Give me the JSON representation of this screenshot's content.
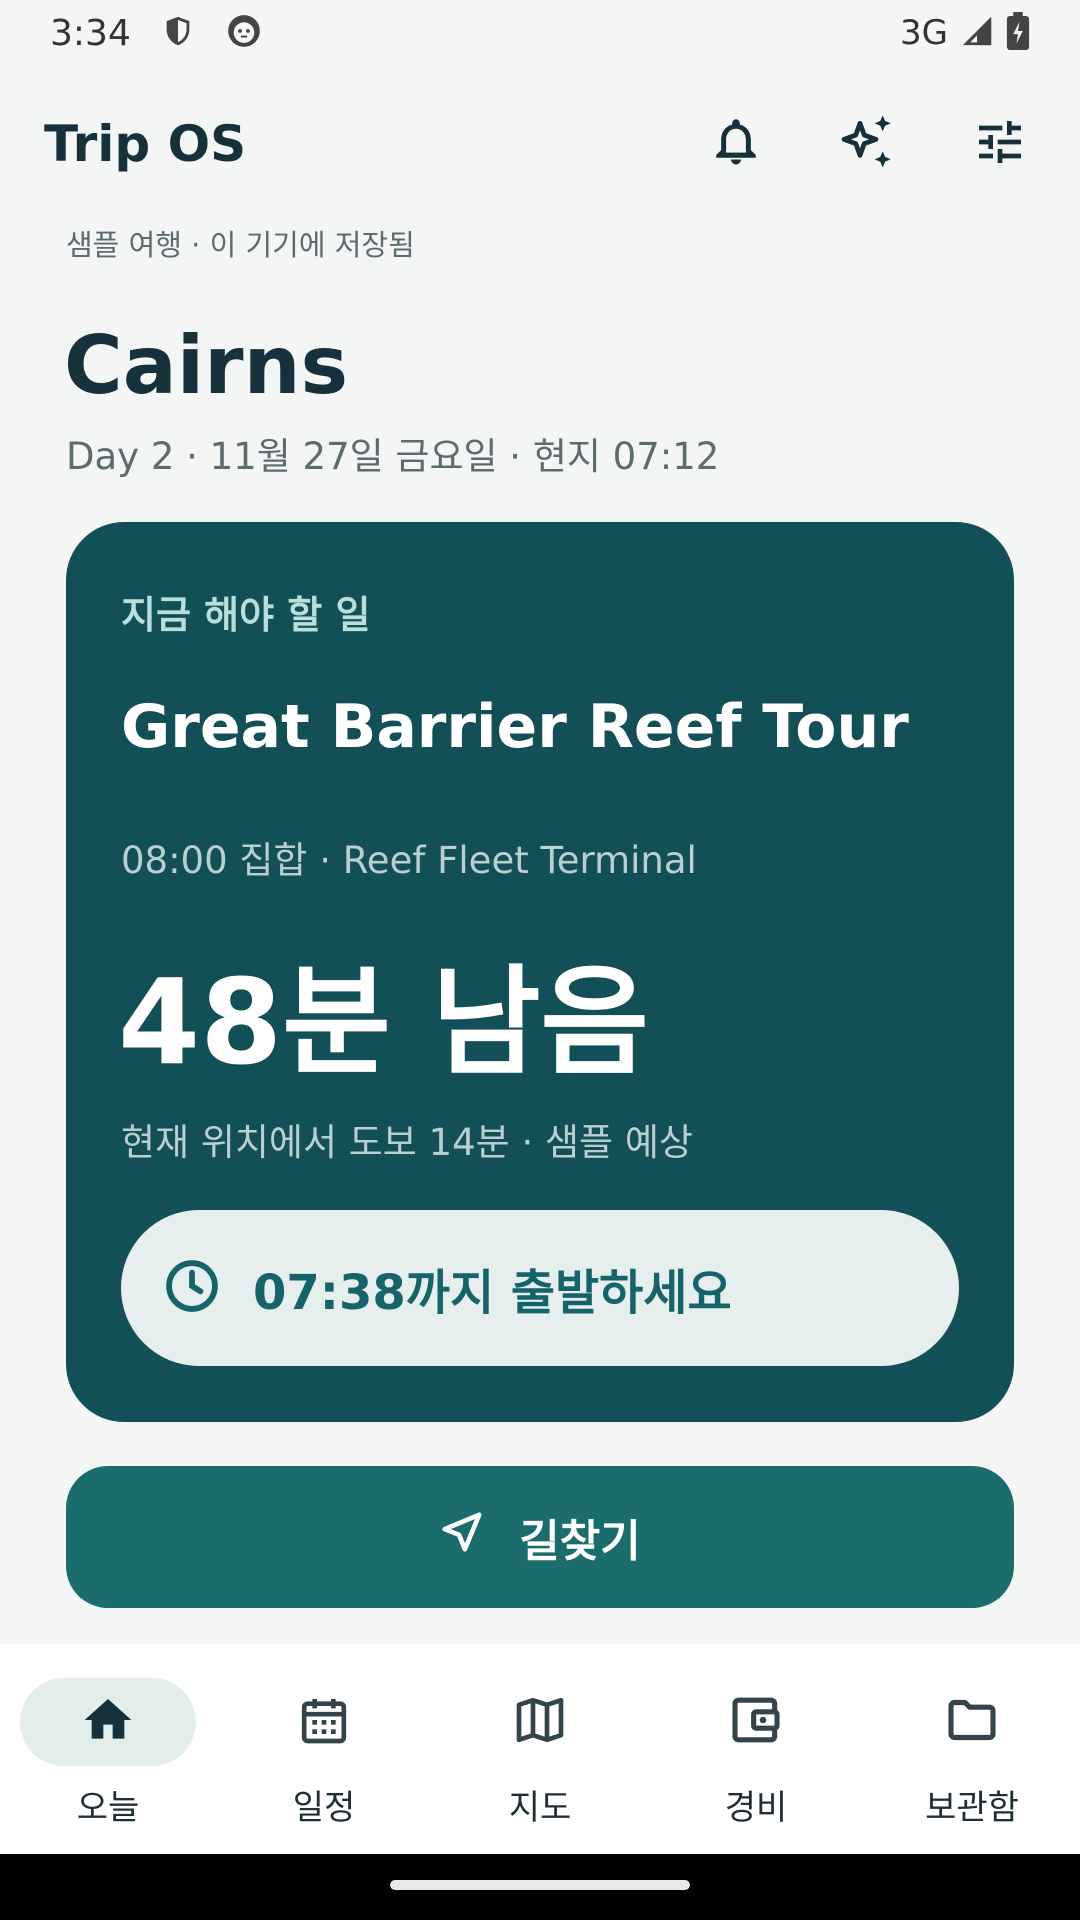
{
  "status_bar": {
    "time": "3:34",
    "network": "3G"
  },
  "app_bar": {
    "title": "Trip OS",
    "actions": [
      "bell-icon",
      "sparkle-icon",
      "tune-icon"
    ]
  },
  "trip": {
    "note": "샘플 여행 · 이 기기에 저장됨",
    "city": "Cairns",
    "date_line": "Day 2 · 11월 27일 금요일 · 현지 07:12"
  },
  "next_task": {
    "label": "지금 해야 할 일",
    "title": "Great Barrier Reef Tour",
    "meeting": "08:00 집합 · Reef Fleet Terminal",
    "countdown": "48분 남음",
    "walk": "현재 위치에서 도보 14분 · 샘플 예상",
    "depart": "07:38까지 출발하세요"
  },
  "navigate_button": {
    "label": "길찾기"
  },
  "bottom_nav": {
    "items": [
      {
        "label": "오늘",
        "icon": "home-icon",
        "active": true
      },
      {
        "label": "일정",
        "icon": "calendar-icon",
        "active": false
      },
      {
        "label": "지도",
        "icon": "map-icon",
        "active": false
      },
      {
        "label": "경비",
        "icon": "wallet-icon",
        "active": false
      },
      {
        "label": "보관함",
        "icon": "folder-icon",
        "active": false
      }
    ]
  },
  "colors": {
    "background": "#f4f6f6",
    "card": "#134f56",
    "accent": "#1b6c6c",
    "pill": "#e6efed"
  }
}
